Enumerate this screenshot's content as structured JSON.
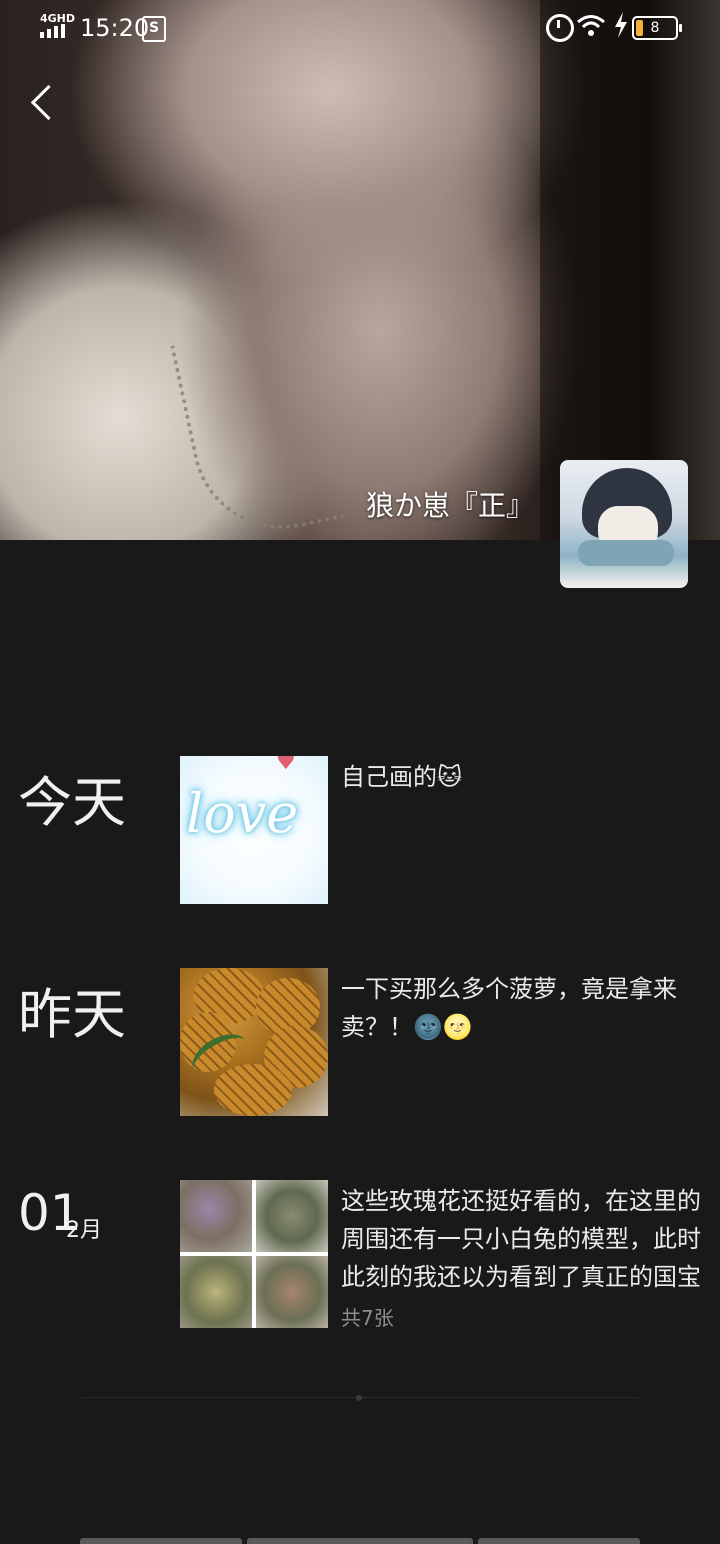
{
  "status_bar": {
    "network": "4GHD",
    "time": "15:20",
    "battery": "8"
  },
  "profile": {
    "nickname": "狼か崽『正』"
  },
  "feed": [
    {
      "date": "今天",
      "text": "自己画的🐱",
      "thumb": "love",
      "thumb_text": "love"
    },
    {
      "date": "昨天",
      "text": "一下买那么多个菠萝，竟是拿来卖？！🌚🌝",
      "thumb": "pineapple"
    },
    {
      "date_day": "01",
      "date_month": "2月",
      "text": "这些玫瑰花还挺好看的，在这里的周围还有一只小白兔的模型，此时此刻的我还以为看到了真正的国宝呢…",
      "count": "共7张",
      "thumb": "grid"
    }
  ],
  "icons": [
    "signal-icon",
    "screenshot-app-icon",
    "alarm-icon",
    "wifi-icon",
    "charging-icon",
    "battery-icon",
    "back-icon"
  ]
}
